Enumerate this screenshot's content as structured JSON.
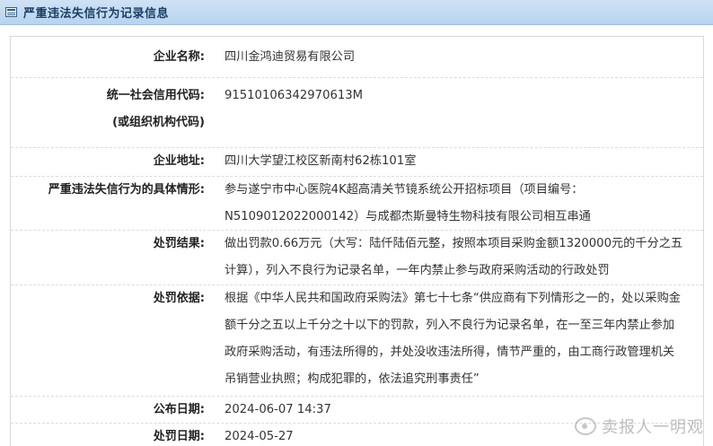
{
  "header": {
    "title": "严重违法失信行为记录信息",
    "icon": "list-icon"
  },
  "record": {
    "company_name": {
      "label": "企业名称:",
      "value": "四川金鸿迪贸易有限公司"
    },
    "credit_code": {
      "label_line1": "统一社会信用代码:",
      "label_line2": "(或组织机构代码)",
      "value": "91510106342970613M"
    },
    "address": {
      "label": "企业地址:",
      "value": "四川大学望江校区新南村62栋101室"
    },
    "situation": {
      "label": "严重违法失信行为的具体情形:",
      "value": "参与遂宁市中心医院4K超高清关节镜系统公开招标项目（项目编号：N5109012022000142）与成都杰斯曼特生物科技有限公司相互串通"
    },
    "result": {
      "label": "处罚结果:",
      "value": "做出罚款0.66万元（大写：陆仟陆佰元整，按照本项目采购金额1320000元的千分之五计算），列入不良行为记录名单，一年内禁止参与政府采购活动的行政处罚"
    },
    "basis": {
      "label": "处罚依据:",
      "value": "根据《中华人民共和国政府采购法》第七十七条“供应商有下列情形之一的，处以采购金额千分之五以上千分之十以下的罚款，列入不良行为记录名单，在一至三年内禁止参加政府采购活动，有违法所得的，并处没收违法所得，情节严重的，由工商行政管理机关吊销营业执照；构成犯罪的，依法追究刑事责任”"
    },
    "publish_date": {
      "label": "公布日期:",
      "value": "2024-06-07 14:37"
    },
    "penalty_date": {
      "label": "处罚日期:",
      "value": "2024-05-27"
    }
  },
  "watermark": {
    "text": "卖报人一明观",
    "icon": "weibo-logo-icon"
  }
}
